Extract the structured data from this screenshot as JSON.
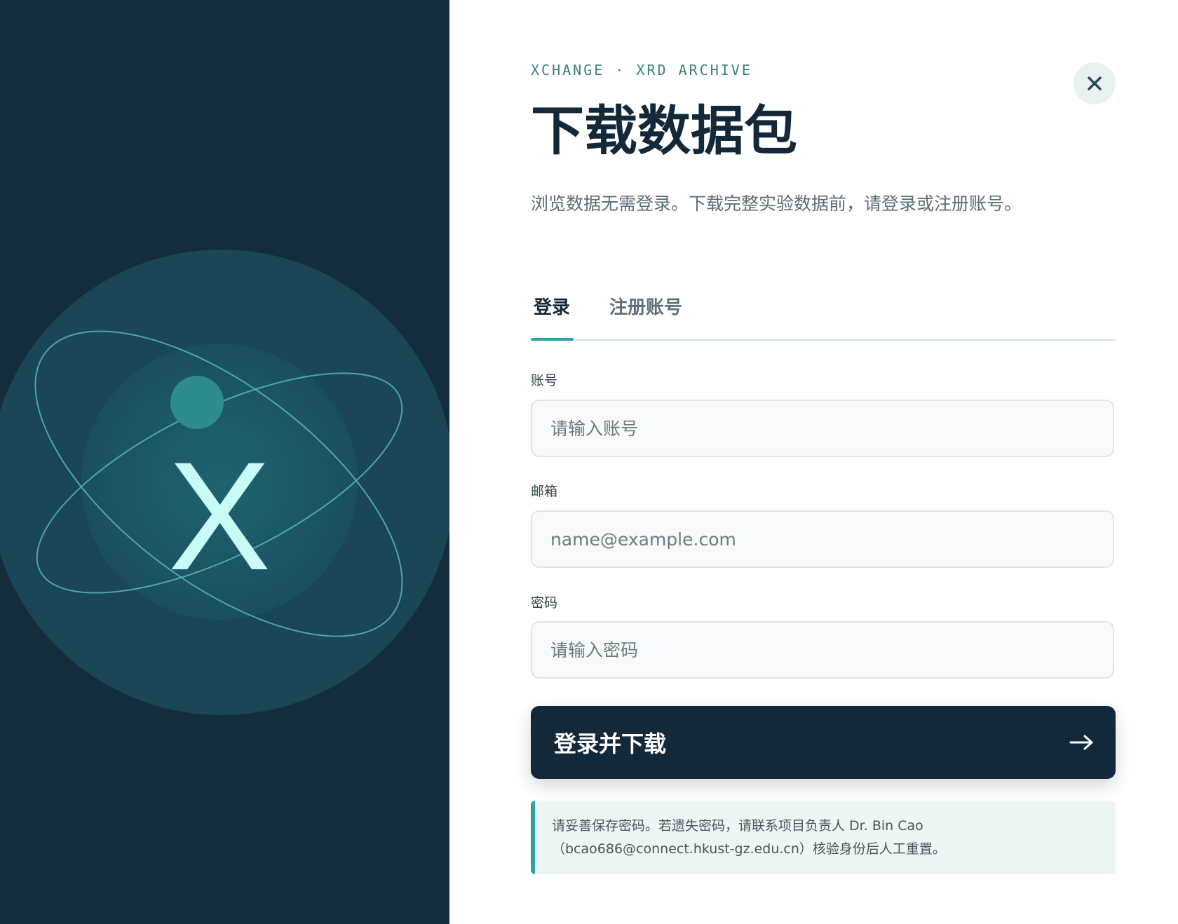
{
  "brand": {
    "logo_letter": "X",
    "colors": {
      "background": "#142d3d",
      "accent": "#2aa4a8",
      "glyph": "#c9fbf6"
    }
  },
  "header": {
    "eyebrow": "XCHANGE · XRD ARCHIVE",
    "title": "下载数据包",
    "description": "浏览数据无需登录。下载完整实验数据前，请登录或注册账号。",
    "close_icon": "close-icon"
  },
  "tabs": [
    {
      "label": "登录",
      "active": true
    },
    {
      "label": "注册账号",
      "active": false
    }
  ],
  "form": {
    "account": {
      "label": "账号",
      "placeholder": "请输入账号",
      "value": ""
    },
    "email": {
      "label": "邮箱",
      "placeholder": "name@example.com",
      "value": ""
    },
    "password": {
      "label": "密码",
      "placeholder": "请输入密码",
      "value": ""
    },
    "submit_label": "登录并下载",
    "submit_icon": "arrow-right-icon"
  },
  "notice": {
    "line1": "请妥善保存密码。若遗失密码，请联系项目负责人 Dr. Bin Cao",
    "line2": "（bcao686@connect.hkust-gz.edu.cn）核验身份后人工重置。"
  }
}
